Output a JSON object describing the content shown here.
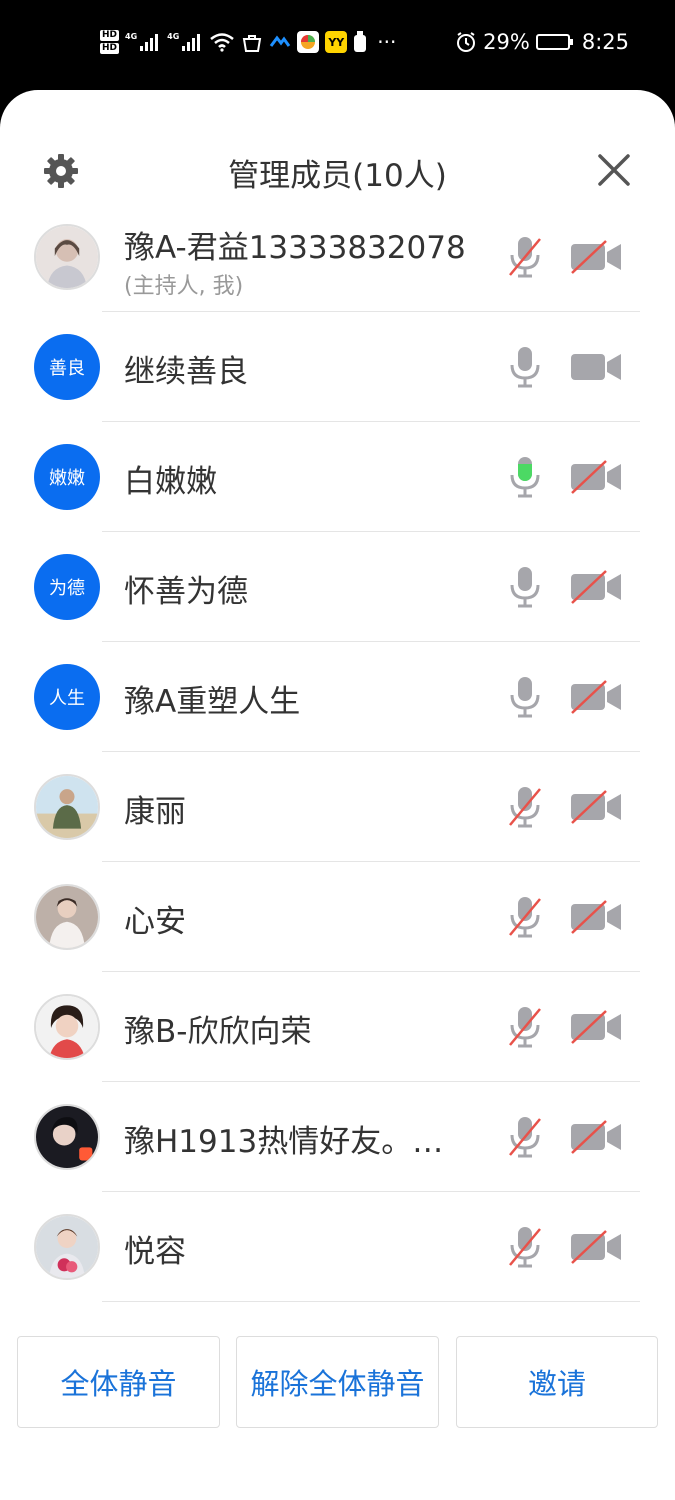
{
  "status_bar": {
    "hd_labels": [
      "HD",
      "HD"
    ],
    "network_labels": [
      "4G",
      "4G"
    ],
    "app_badge_label": "YY",
    "more": "···",
    "battery_percent": "29%",
    "time": "8:25"
  },
  "header": {
    "title": "管理成员(10人)"
  },
  "members": [
    {
      "name": "豫A-君益13333832078",
      "subtitle": "(主持人, 我)",
      "avatar_type": "photo",
      "avatar_text": "",
      "mic": "muted",
      "camera": "off"
    },
    {
      "name": "继续善良",
      "avatar_type": "text",
      "avatar_text": "善良",
      "mic": "on",
      "camera": "on"
    },
    {
      "name": "白嫩嫩",
      "avatar_type": "text",
      "avatar_text": "嫩嫩",
      "mic": "speaking",
      "camera": "off"
    },
    {
      "name": "怀善为德",
      "avatar_type": "text",
      "avatar_text": "为德",
      "mic": "on",
      "camera": "off"
    },
    {
      "name": "豫A重塑人生",
      "avatar_type": "text",
      "avatar_text": "人生",
      "mic": "on",
      "camera": "off"
    },
    {
      "name": "康丽",
      "avatar_type": "photo",
      "avatar_text": "",
      "mic": "muted",
      "camera": "off"
    },
    {
      "name": "心安",
      "avatar_type": "photo",
      "avatar_text": "",
      "mic": "muted",
      "camera": "off"
    },
    {
      "name": "豫B-欣欣向荣   ",
      "avatar_type": "photo",
      "avatar_text": "",
      "mic": "muted",
      "camera": "off"
    },
    {
      "name": "豫H1913热情好友。…",
      "avatar_type": "photo",
      "avatar_text": "",
      "mic": "muted",
      "camera": "off"
    },
    {
      "name": "悦容",
      "avatar_type": "photo",
      "avatar_text": "",
      "mic": "muted",
      "camera": "off"
    }
  ],
  "footer": {
    "mute_all": "全体静音",
    "unmute_all": "解除全体静音",
    "invite": "邀请"
  },
  "colors": {
    "accent": "#1a73d9",
    "avatar_blue": "#0a6df0",
    "icon_gray": "#a6a6ab",
    "muted_red": "#e8524a",
    "speaking_green": "#4cd964"
  }
}
